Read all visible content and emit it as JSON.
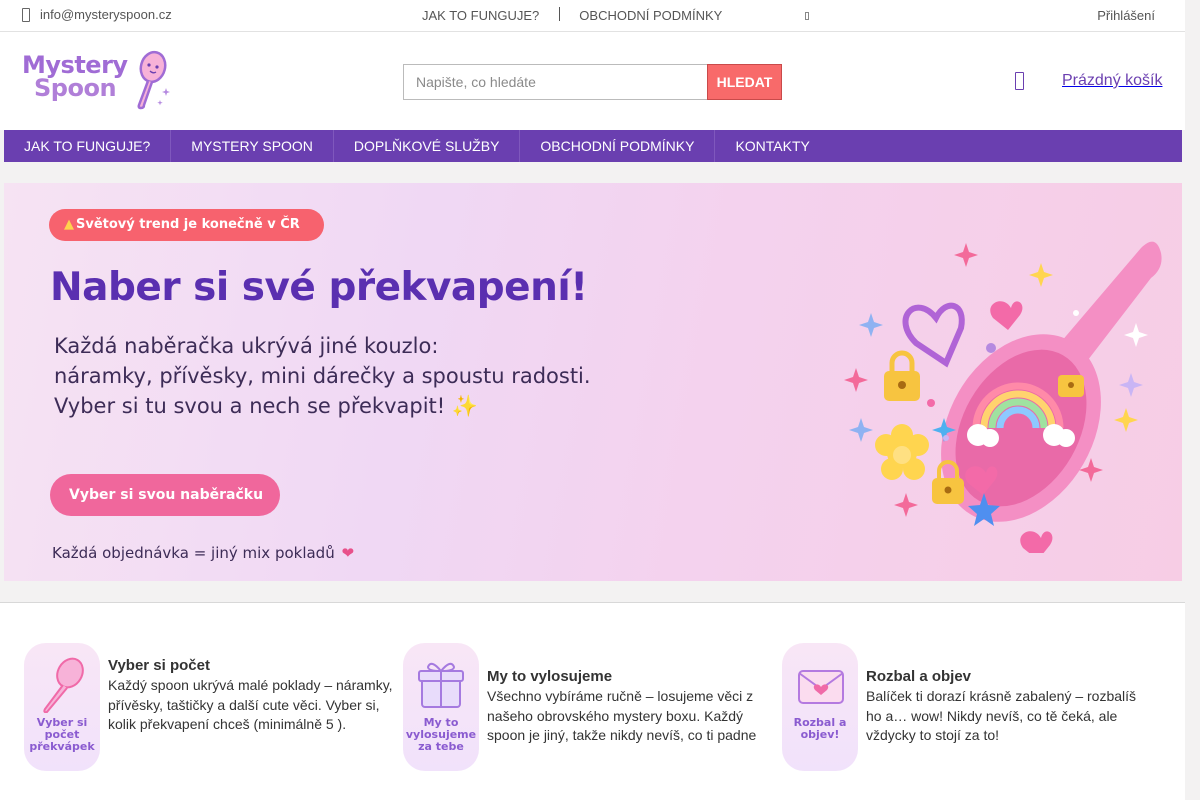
{
  "topbar": {
    "email": "info@mysteryspoon.cz",
    "links": [
      "JAK TO FUNGUJE?",
      "OBCHODNÍ PODMÍNKY"
    ],
    "login": "Přihlášení"
  },
  "header": {
    "logo_line1": "Mystery",
    "logo_line2": "Spoon",
    "search_placeholder": "Napište, co hledáte",
    "search_button": "HLEDAT",
    "cart_label": "Prázdný košík"
  },
  "nav": {
    "items": [
      "JAK TO FUNGUJE?",
      "MYSTERY SPOON",
      "DOPLŇKOVÉ SLUŽBY",
      "OBCHODNÍ PODMÍNKY",
      "KONTAKTY"
    ]
  },
  "banner": {
    "pill": "Světový trend je konečně v ČR",
    "headline": "Naber si své překvapení!",
    "sub_lines": [
      "Každá naběračka ukrývá jiné kouzlo:",
      "náramky, přívěsky, mini dárečky a spoustu radosti.",
      "Vyber si tu svou a nech se překvapit! ✨"
    ],
    "cta": "Vyber si svou naběračku",
    "footer": "Každá objednávka = jiný mix pokladů"
  },
  "features": [
    {
      "badge": "Vyber si počet překvápek",
      "title": "Vyber si počet",
      "text": "Každý spoon ukrývá malé poklady – náramky, přívěsky, taštičky a další cute věci. Vyber si, kolik překvapení chceš (minimálně 5 ).",
      "icon": "spoon-icon"
    },
    {
      "badge": "My to vylosujeme za tebe",
      "title": "My to vylosujeme",
      "text": "Všechno vybíráme ručně – losujeme věci z našeho obrovského mystery boxu. Každý spoon je jiný, takže nikdy nevíš, co ti padne ",
      "icon": "gift-icon"
    },
    {
      "badge": "Rozbal a objev!",
      "title": "Rozbal a objev",
      "text": "Balíček ti dorazí krásně zabalený – rozbalíš ho a… wow!  Nikdy nevíš, co tě čeká, ale vždycky to stojí za to!",
      "icon": "envelope-icon"
    }
  ],
  "colors": {
    "brand_purple": "#6a3fb0",
    "search_button": "#f86a6a",
    "cta_pink": "#f0679c",
    "pill_red": "#f7626e"
  }
}
